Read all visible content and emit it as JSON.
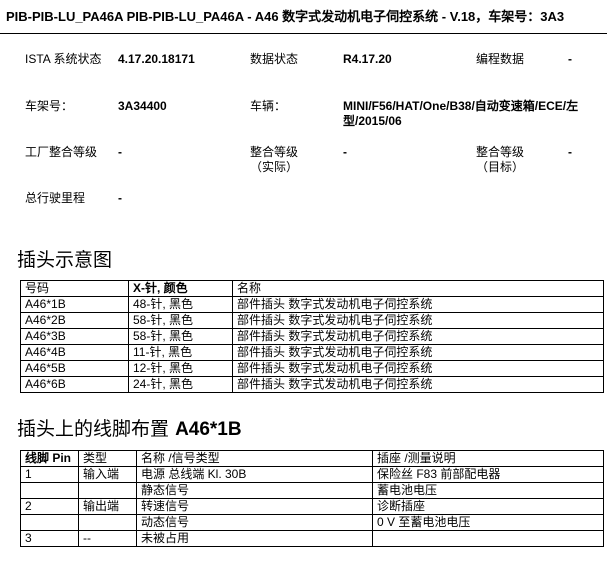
{
  "header": {
    "title": "PIB-PIB-LU_PA46A   PIB-PIB-LU_PA46A - A46 数字式发动机电子伺控系统 - V.18，车架号：3A3"
  },
  "info": {
    "istaLabel": "ISTA 系统状态",
    "istaValue": "4.17.20.18171",
    "dataStatusLabel": "数据状态",
    "dataStatusValue": "R4.17.20",
    "progDataLabel": "编程数据",
    "progDataValue": "-",
    "vinLabel": "车架号：",
    "vinValue": "3A34400",
    "vehicleLabel": "车辆：",
    "vehicleValue": "MINI/F56/HAT/One/B38/自动变速箱/ECE/左型/2015/06",
    "factoryLevelLabel": "工厂整合等级",
    "factoryLevelValue": "-",
    "actualLevelLabel": "整合等级（实际）",
    "actualLevelValue": "-",
    "targetLevelLabel": "整合等级（目标）",
    "targetLevelValue": "-",
    "mileageLabel": "总行驶里程",
    "mileageValue": "-"
  },
  "connectorSection": {
    "title": "插头示意图",
    "headers": [
      "号码",
      "X-针, 颜色",
      "名称"
    ],
    "rows": [
      [
        "A46*1B",
        "48-针, 黑色",
        "部件插头 数字式发动机电子伺控系统"
      ],
      [
        "A46*2B",
        "58-针, 黑色",
        "部件插头 数字式发动机电子伺控系统"
      ],
      [
        "A46*3B",
        "58-针, 黑色",
        "部件插头 数字式发动机电子伺控系统"
      ],
      [
        "A46*4B",
        "11-针, 黑色",
        "部件插头 数字式发动机电子伺控系统"
      ],
      [
        "A46*5B",
        "12-针, 黑色",
        "部件插头 数字式发动机电子伺控系统"
      ],
      [
        "A46*6B",
        "24-针, 黑色",
        "部件插头 数字式发动机电子伺控系统"
      ]
    ]
  },
  "pinSection": {
    "title": "插头上的线脚布置",
    "titleCode": "A46*1B",
    "headers": [
      "线脚 Pin",
      "类型",
      "名称 /信号类型",
      "插座 /测量说明"
    ],
    "rows": [
      [
        "1",
        "输入端",
        "电源 总线端 Kl. 30B",
        "保险丝 F83 前部配电器"
      ],
      [
        "",
        "",
        "静态信号",
        "蓄电池电压"
      ],
      [
        "2",
        "输出端",
        "转速信号",
        "诊断插座"
      ],
      [
        "",
        "",
        "动态信号",
        "0 V 至蓄电池电压"
      ],
      [
        "3",
        "--",
        "未被占用",
        ""
      ]
    ]
  }
}
